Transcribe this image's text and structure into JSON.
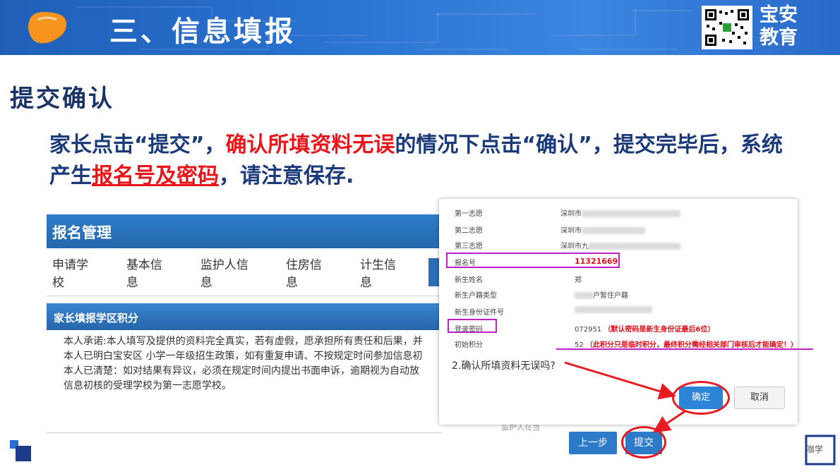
{
  "banner": {
    "title": "三、信息填报",
    "brand_line1": "宝安",
    "brand_line2": "教育"
  },
  "heading": "提交确认",
  "intro": {
    "part1": "家长点击“提交”，",
    "part2": "确认所填资料无误",
    "part3": "的情况下点击“确认”，提交完毕后，系统产生",
    "part4": "报名号及密码",
    "part5": "，请注意保存."
  },
  "panel": {
    "header": "报名管理",
    "tabs": [
      "申请学校",
      "基本信息",
      "监护人信息",
      "住房信息",
      "计生信息"
    ],
    "section": "家长填报学区积分",
    "pledge": [
      "本人承诺:本人填写及提供的资料完全真实，若有虚假，愿承担所有责任和后果，并",
      "本人已明白宝安区 小学一年级招生政策，如有重复申请、不按规定时间参加信息初",
      "本人已清楚：如对结果有异议，必须在规定时间内提出书面申诉，逾期视为自动放",
      "信息初核的受理学校为第一志愿学校。"
    ]
  },
  "popup": {
    "rows": [
      {
        "label": "第一志愿",
        "value": "深圳市"
      },
      {
        "label": "第二志愿",
        "value": "深圳市"
      },
      {
        "label": "第三志愿",
        "value": "深圳市九"
      },
      {
        "label": "报名号",
        "value": "11321669"
      },
      {
        "label": "新生姓名",
        "value": "郑"
      },
      {
        "label": "新生户籍类型",
        "value": "户暂住户籍"
      },
      {
        "label": "新生身份证件号",
        "value": ""
      },
      {
        "label": "登录密码",
        "value": "072951"
      },
      {
        "label": "初始积分",
        "value": "52"
      }
    ],
    "password_note": "（默认密码是新生身份证最后6位）",
    "score_note": "（此积分只是临时积分，最终积分需经相关部门审核后才能确定！）",
    "question": "2.确认所填资料无误吗?",
    "ok_label": "确定",
    "cancel_label": "取消"
  },
  "bottom": {
    "prev_label": "上一步",
    "submit_label": "提交",
    "partial_text": "监护人在当"
  },
  "corner_text": "咖学"
}
